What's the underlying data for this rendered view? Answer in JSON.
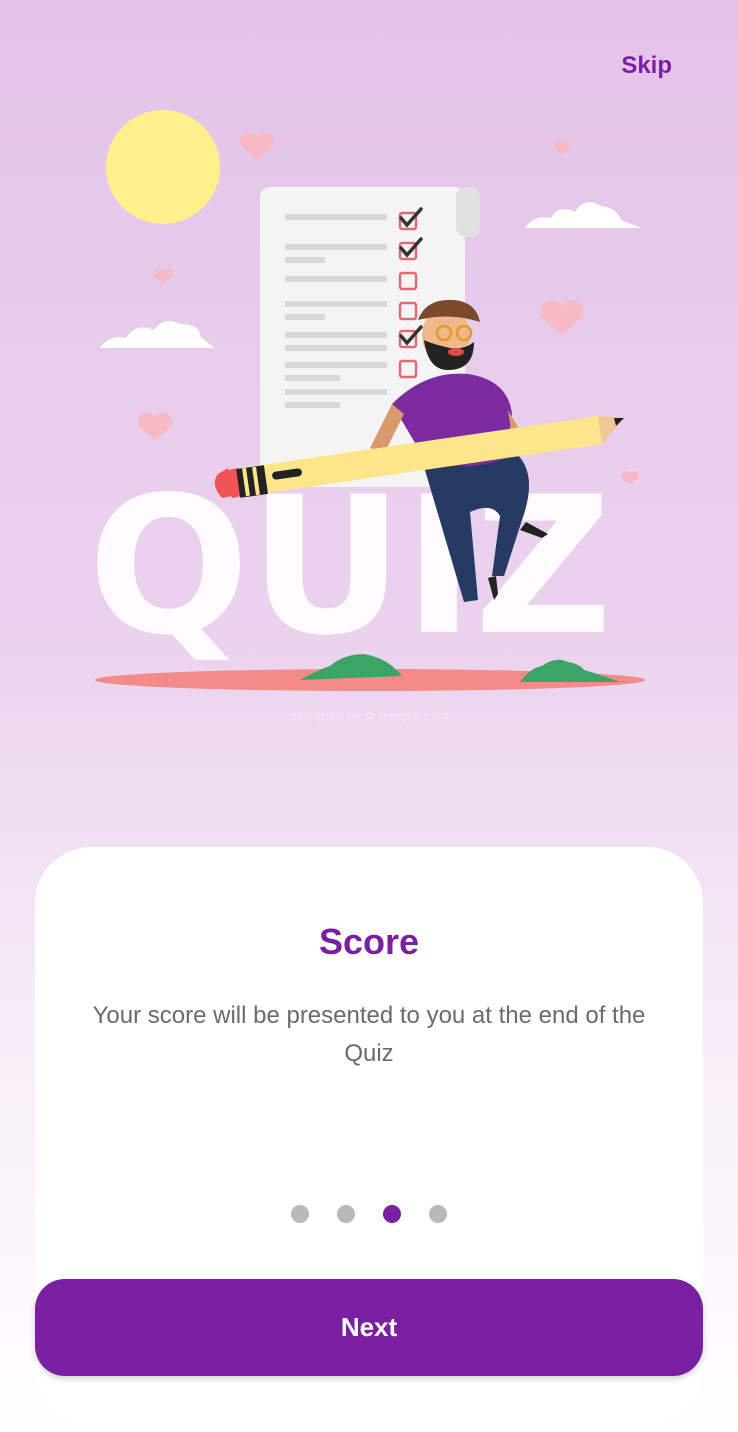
{
  "header": {
    "skip_label": "Skip"
  },
  "illustration": {
    "word": "QUIZ",
    "credit": "designed by ✿ freepik.com"
  },
  "card": {
    "title": "Score",
    "description": "Your score will be presented to you at the end of the Quiz"
  },
  "pager": {
    "total_pages": 4,
    "current_page": 3
  },
  "footer": {
    "next_label": "Next"
  },
  "colors": {
    "accent": "#7b1fa2",
    "dot_inactive": "#b9b9b9",
    "text_secondary": "#6b6b6b"
  }
}
